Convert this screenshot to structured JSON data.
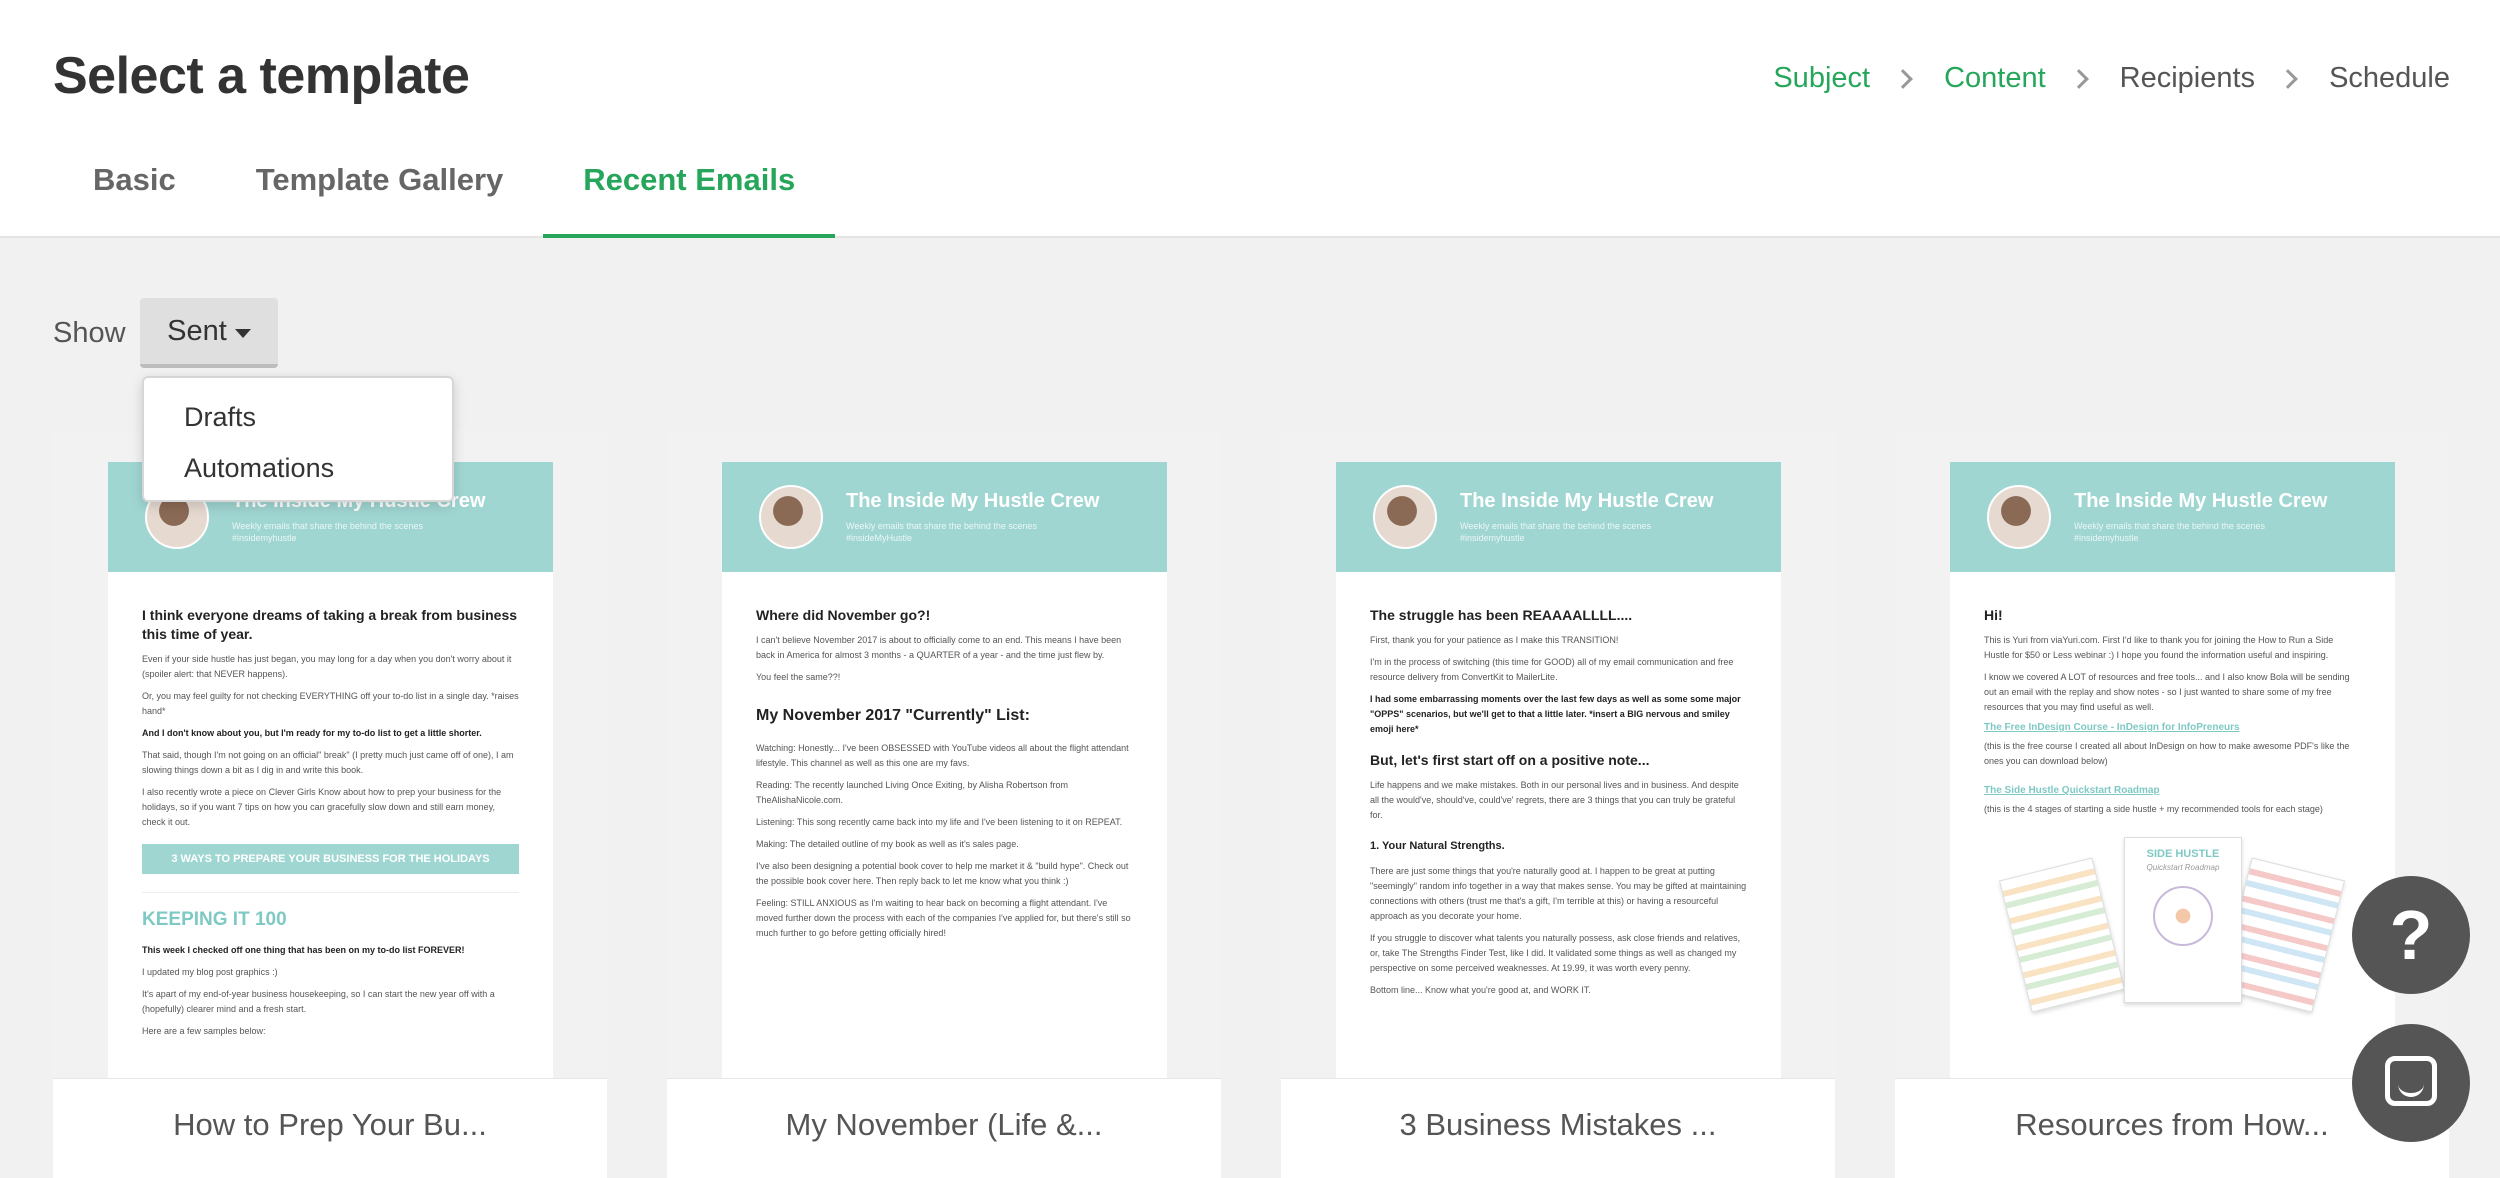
{
  "header": {
    "title": "Select a template",
    "steps": [
      "Subject",
      "Content",
      "Recipients",
      "Schedule"
    ]
  },
  "tabs": [
    "Basic",
    "Template Gallery",
    "Recent Emails"
  ],
  "filter": {
    "label": "Show",
    "selected": "Sent",
    "options": [
      "Drafts",
      "Automations"
    ]
  },
  "colors": {
    "accent": "#26a65b",
    "banner": "#a0d6d2"
  },
  "cards": [
    {
      "name": "How to Prep Your Bu...",
      "banner_title": "The Inside My Hustle Crew",
      "banner_sub": "Weekly emails that share the behind the scenes",
      "banner_tag": "#insidemyhustle",
      "heading": "I think everyone dreams of taking a break from business this time of year.",
      "p1": "Even if your side hustle has just began, you may long for a day when you don't worry about it (spoiler alert: that NEVER happens).",
      "p2": "Or, you may feel guilty for not checking EVERYTHING off your to-do list in a single day. *raises hand*",
      "p3": "And I don't know about you, but I'm ready for my to-do list to get a little shorter.",
      "p4": "That said, though I'm not going on an official\" break\" (I pretty much just came off of one), I am slowing things down a bit as I dig in and write this book.",
      "p5": "I also recently wrote a piece on Clever Girls Know about how to prep your business for the holidays, so if you want 7 tips on how you can gracefully slow down and still earn money, check it out.",
      "button": "3 WAYS TO PREPARE YOUR BUSINESS FOR THE HOLIDAYS",
      "keeping": "KEEPING IT 100",
      "p6": "This week I checked off one thing that has been on my to-do list FOREVER!",
      "p7": "I updated my blog post graphics :)",
      "p8": "It's apart of my end-of-year business housekeeping, so I can start the new year off with a (hopefully) clearer mind and a fresh start.",
      "p9": "Here are a few samples below:"
    },
    {
      "name": "My November (Life &...",
      "banner_title": "The Inside My Hustle Crew",
      "banner_sub": "Weekly emails that share the behind the scenes",
      "banner_tag": "#insideMyHustle",
      "heading": "Where did November go?!",
      "p1": "I can't believe November 2017 is about to officially come to an end. This means I have been back in America for almost 3 months - a QUARTER of a year - and the time just flew by.",
      "p2": "You feel the same??!",
      "h2": "My November 2017 \"Currently\" List:",
      "p3": "Watching: Honestly... I've been OBSESSED with YouTube videos all about the flight attendant lifestyle. This channel as well as this one are my favs.",
      "p4": "Reading: The recently launched Living Once Exiting, by Alisha Robertson from TheAlishaNicole.com.",
      "p5": "Listening: This song recently came back into my life and I've been listening to it on REPEAT.",
      "p6": "Making: The detailed outline of my book as well as it's sales page.",
      "p7": "I've also been designing a potential book cover to help me market it & \"build hype\". Check out the possible book cover here. Then reply back to let me know what you think :)",
      "p8": "Feeling: STILL ANXIOUS as I'm waiting to hear back on becoming a flight attendant. I've moved further down the process with each of the companies I've applied for, but there's still so much further to go before getting officially hired!"
    },
    {
      "name": "3 Business Mistakes ...",
      "banner_title": "The Inside My Hustle Crew",
      "banner_sub": "Weekly emails that share the behind the scenes",
      "banner_tag": "#insidemyhustle",
      "heading": "The struggle has been REAAAALLLL....",
      "p1": "First, thank you for your patience as I make this TRANSITION!",
      "p2": "I'm in the process of switching (this time for GOOD) all of my email communication and free resource delivery from ConvertKit to MailerLite.",
      "p3": "I had some embarrassing moments over the last few days as well as some some major \"OPPS\" scenarios, but we'll get to that a little later. *insert a BIG nervous and smiley emoji here*",
      "h2": "But, let's first start off on a positive note...",
      "p4": "Life happens and we make mistakes. Both in our personal lives and in business. And despite all the would've, should've, could've' regrets, there are 3 things that you can truly be grateful for.",
      "h3": "1. Your Natural Strengths.",
      "p5": "There are just some things that you're naturally good at. I happen to be great at putting \"seemingly\" random info together in a way that makes sense. You may be gifted at maintaining connections with others (trust me that's a gift, I'm terrible at this) or having a resourceful approach as you decorate your home.",
      "p6": "If you struggle to discover what talents you naturally possess, ask close friends and relatives, or, take The Strengths Finder Test, like I did. It validated some things as well as changed my perspective on some perceived weaknesses. At 19.99, it was worth every penny.",
      "p7": "Bottom line... Know what you're good at, and WORK IT."
    },
    {
      "name": "Resources from How...",
      "banner_title": "The Inside My Hustle Crew",
      "banner_sub": "Weekly emails that share the behind the scenes",
      "banner_tag": "#insidemyhustle",
      "heading": "Hi!",
      "p1": "This is Yuri from viaYuri.com. First I'd like to thank you for joining the How to Run a Side Hustle for $50 or Less webinar :) I hope you found the information useful and inspiring.",
      "p2": "I know we covered A LOT of resources and free tools... and I also know Bola will be sending out an email with the replay and show notes - so I just wanted to share some of my free resources that you may find useful as well.",
      "link1": "The Free InDesign Course - InDesign for InfoPreneurs",
      "p3": "(this is the free course I created all about InDesign on how to make awesome PDF's like the ones you can download below)",
      "link2": "The Side Hustle Quickstart Roadmap",
      "p4": "(this is the 4 stages of starting a side hustle + my recommended tools for each stage)",
      "roadmap_title": "SIDE HUSTLE",
      "roadmap_sub": "Quickstart Roadmap"
    }
  ],
  "help": {
    "label": "?"
  }
}
